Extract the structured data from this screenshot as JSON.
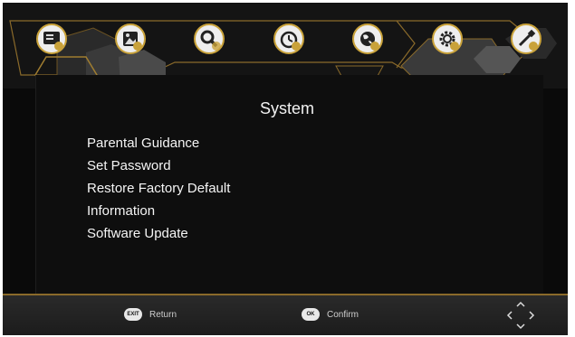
{
  "colors": {
    "accent_gold": "#c9a23a",
    "background": "#0a0a0a",
    "text": "#f5f5f5"
  },
  "nav": {
    "icons": [
      {
        "name": "tv-program-icon"
      },
      {
        "name": "picture-icon"
      },
      {
        "name": "search-icon"
      },
      {
        "name": "timer-clock-icon"
      },
      {
        "name": "globe-language-icon"
      },
      {
        "name": "settings-gear-icon",
        "selected": true
      },
      {
        "name": "usb-icon"
      }
    ]
  },
  "page": {
    "title": "System"
  },
  "menu": {
    "items": [
      "Parental Guidance",
      "Set Password",
      "Restore Factory Default",
      "Information",
      "Software Update"
    ]
  },
  "footer": {
    "return_key": "EXIT",
    "return_label": "Return",
    "confirm_key": "OK",
    "confirm_label": "Confirm",
    "navigation_icon": "direction-arrows-icon"
  }
}
